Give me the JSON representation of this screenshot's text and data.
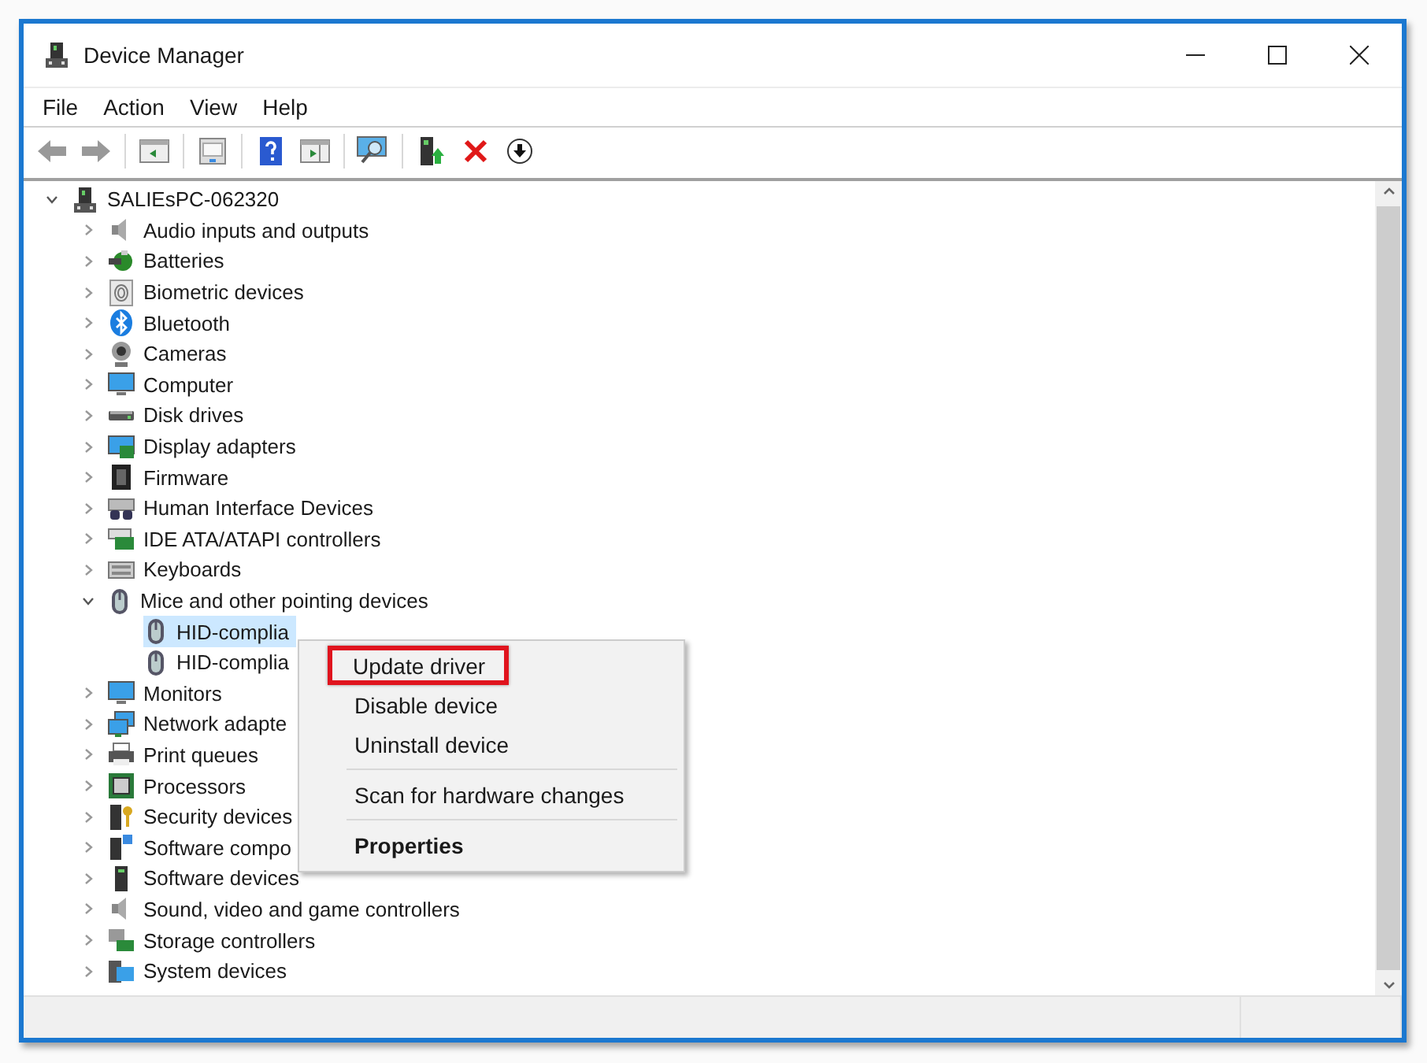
{
  "window": {
    "title": "Device Manager"
  },
  "menu_bar": [
    {
      "label": "File"
    },
    {
      "label": "Action"
    },
    {
      "label": "View"
    },
    {
      "label": "Help"
    }
  ],
  "tree": {
    "label": "SALIEsPC-062320",
    "expanded": true,
    "selected": false,
    "children": [
      {
        "label": "Audio inputs and outputs",
        "expanded": false,
        "selected": false
      },
      {
        "label": "Batteries",
        "expanded": false,
        "selected": false
      },
      {
        "label": "Biometric devices",
        "expanded": false,
        "selected": false
      },
      {
        "label": "Bluetooth",
        "expanded": false,
        "selected": false
      },
      {
        "label": "Cameras",
        "expanded": false,
        "selected": false
      },
      {
        "label": "Computer",
        "expanded": false,
        "selected": false
      },
      {
        "label": "Disk drives",
        "expanded": false,
        "selected": false
      },
      {
        "label": "Display adapters",
        "expanded": false,
        "selected": false
      },
      {
        "label": "Firmware",
        "expanded": false,
        "selected": false
      },
      {
        "label": "Human Interface Devices",
        "expanded": false,
        "selected": false
      },
      {
        "label": "IDE ATA/ATAPI controllers",
        "expanded": false,
        "selected": false
      },
      {
        "label": "Keyboards",
        "expanded": false,
        "selected": false
      },
      {
        "label": "Mice and other pointing devices",
        "expanded": true,
        "selected": false,
        "children": [
          {
            "label": "HID-complia",
            "selected": true
          },
          {
            "label": "HID-complia",
            "selected": false
          }
        ]
      },
      {
        "label": "Monitors",
        "expanded": false,
        "selected": false
      },
      {
        "label": "Network adapte",
        "expanded": false,
        "selected": false
      },
      {
        "label": "Print queues",
        "expanded": false,
        "selected": false
      },
      {
        "label": "Processors",
        "expanded": false,
        "selected": false
      },
      {
        "label": "Security devices",
        "expanded": false,
        "selected": false
      },
      {
        "label": "Software compo",
        "expanded": false,
        "selected": false
      },
      {
        "label": "Software devices",
        "expanded": false,
        "selected": false
      },
      {
        "label": "Sound, video and game controllers",
        "expanded": false,
        "selected": false
      },
      {
        "label": "Storage controllers",
        "expanded": false,
        "selected": false
      },
      {
        "label": "System devices",
        "expanded": false,
        "selected": false
      }
    ]
  },
  "context_menu": [
    {
      "kind": "item",
      "label": "Update driver",
      "highlighted": true,
      "default": false
    },
    {
      "kind": "item",
      "label": "Disable device",
      "highlighted": false,
      "default": false
    },
    {
      "kind": "item",
      "label": "Uninstall device",
      "highlighted": false,
      "default": false
    },
    {
      "kind": "separator"
    },
    {
      "kind": "item",
      "label": "Scan for hardware changes",
      "highlighted": false,
      "default": false
    },
    {
      "kind": "separator"
    },
    {
      "kind": "item",
      "label": "Properties",
      "highlighted": false,
      "default": true
    }
  ]
}
